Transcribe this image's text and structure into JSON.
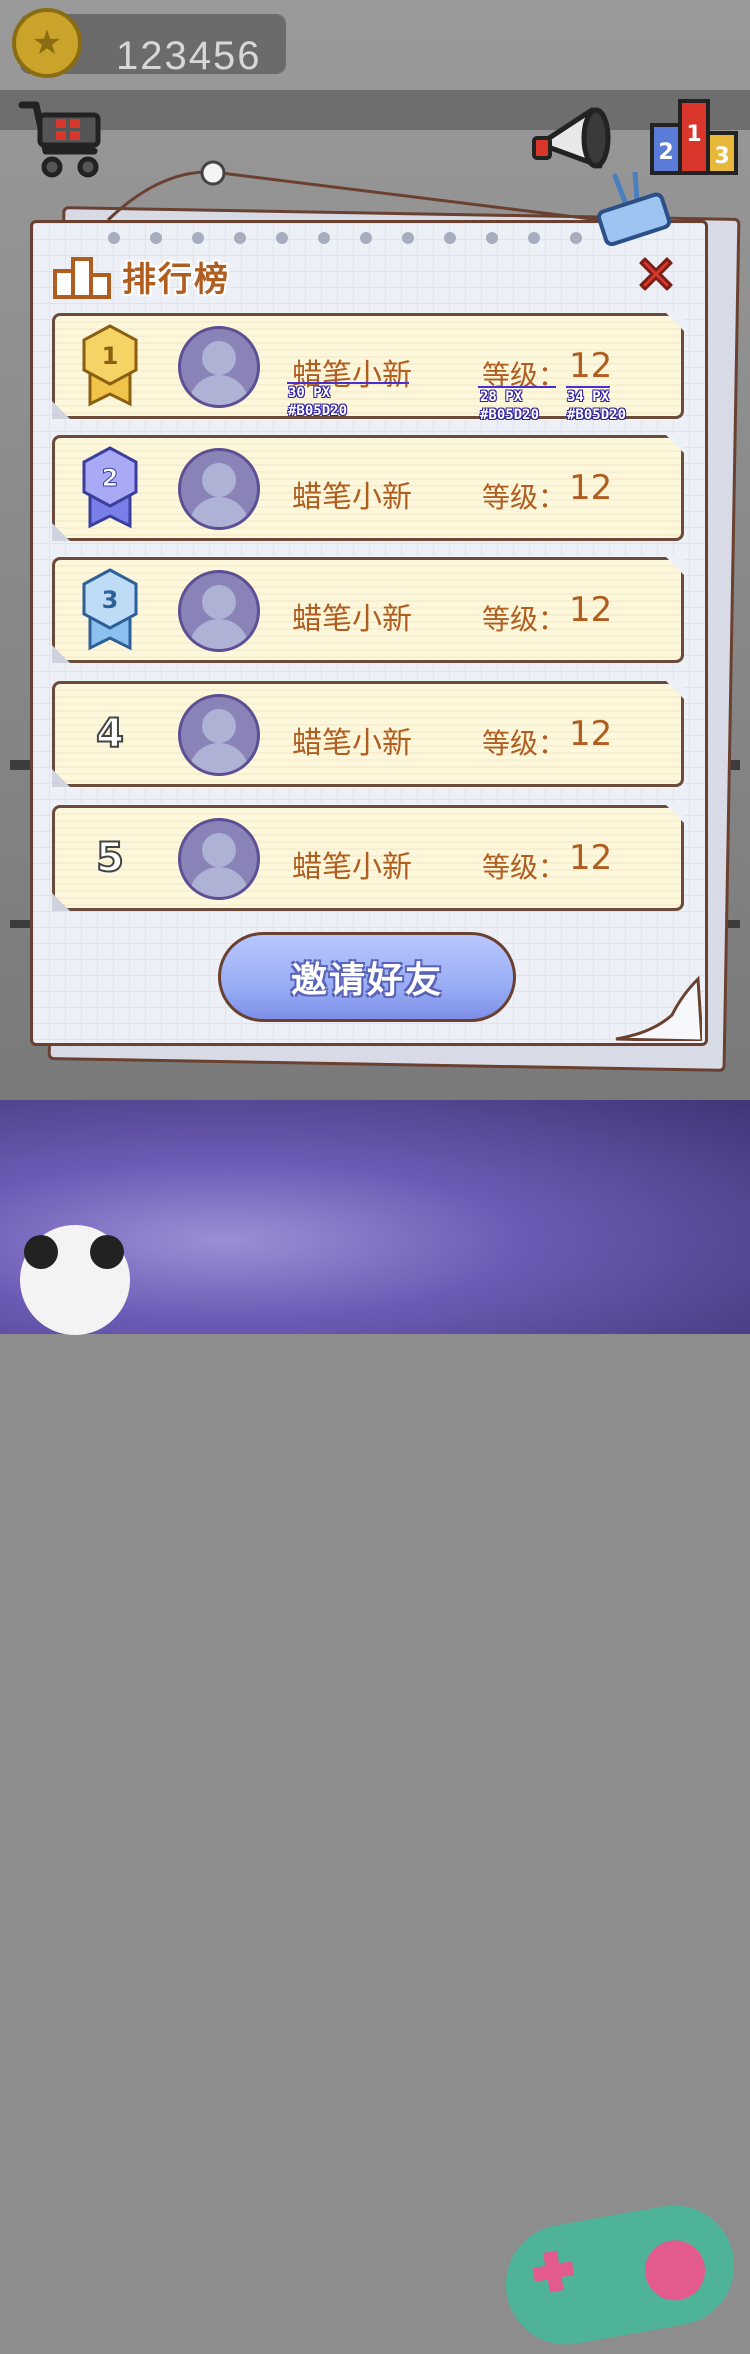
{
  "topbar": {
    "coins": "123456",
    "coin_icon": "star-coin-icon",
    "shop_icon": "shopping-cart-icon",
    "announce_icon": "megaphone-icon",
    "leaderboard_icon": "podium-icon",
    "podium_labels": [
      "2",
      "1",
      "3"
    ]
  },
  "panel": {
    "title": "排行榜",
    "title_icon": "podium-icon",
    "close_icon": "close-icon",
    "invite_label": "邀请好友"
  },
  "rows": [
    {
      "rank": "1",
      "rank_style": "gold-medal",
      "name": "蜡笔小新",
      "level_label": "等级：",
      "level": "12"
    },
    {
      "rank": "2",
      "rank_style": "silver-medal",
      "name": "蜡笔小新",
      "level_label": "等级：",
      "level": "12"
    },
    {
      "rank": "3",
      "rank_style": "bronze-medal",
      "name": "蜡笔小新",
      "level_label": "等级：",
      "level": "12"
    },
    {
      "rank": "4",
      "rank_style": "plain-number",
      "name": "蜡笔小新",
      "level_label": "等级：",
      "level": "12"
    },
    {
      "rank": "5",
      "rank_style": "plain-number",
      "name": "蜡笔小新",
      "level_label": "等级：",
      "level": "12"
    }
  ],
  "annotations": {
    "name_size": "30 PX",
    "name_color": "#B05D20",
    "label_size": "28 PX",
    "label_color": "#B05D20",
    "level_size": "34 PX",
    "level_color": "#B05D20"
  },
  "colors": {
    "text_brown": "#b05d20",
    "row_bg": "#fdf7dc",
    "avatar": "#8a83b8",
    "button": "#9aaef7",
    "close_red": "#d9372b"
  }
}
